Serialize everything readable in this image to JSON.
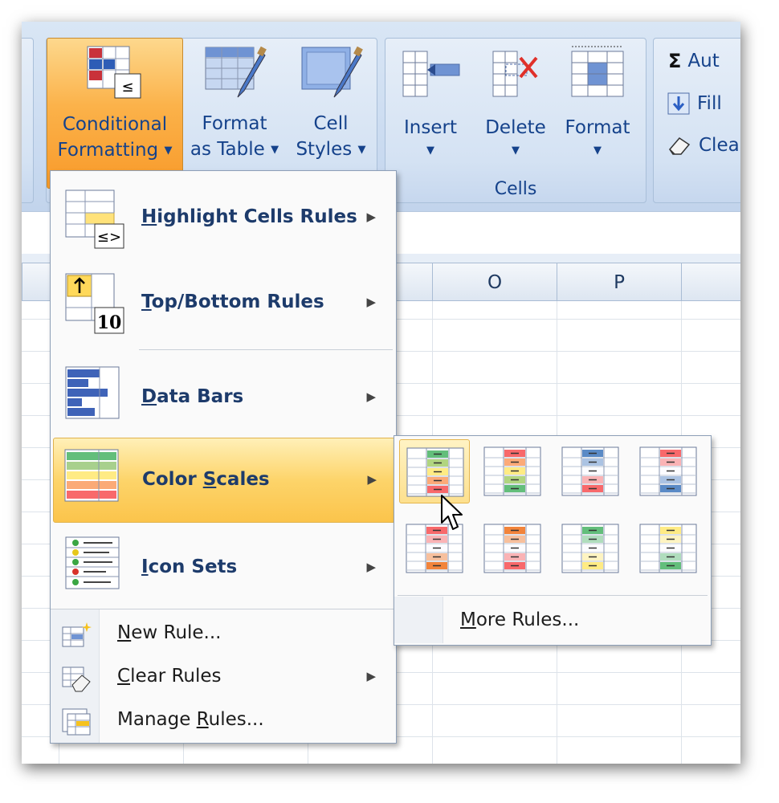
{
  "ribbon": {
    "styles_group": {
      "conditional_formatting": {
        "line1": "Conditional",
        "line2": "Formatting"
      },
      "format_as_table": {
        "line1": "Format",
        "line2": "as Table"
      },
      "cell_styles": {
        "line1": "Cell",
        "line2": "Styles"
      }
    },
    "cells_group": {
      "caption": "Cells",
      "insert": "Insert",
      "delete": "Delete",
      "format": "Format"
    },
    "editing_group": {
      "autosum": "Aut",
      "fill": "Fill",
      "clear": "Clea"
    }
  },
  "grid": {
    "columns": [
      "O",
      "P"
    ]
  },
  "menu": {
    "items": [
      {
        "label": "Highlight Cells Rules",
        "accel": "H",
        "rest": "ighlight Cells Rules"
      },
      {
        "label": "Top/Bottom Rules",
        "accel": "T",
        "rest": "op/Bottom Rules"
      },
      {
        "label": "Data Bars",
        "accel": "D",
        "rest": "ata Bars"
      },
      {
        "label": "Color Scales",
        "pre": "Color ",
        "accel": "S",
        "rest": "cales"
      },
      {
        "label": "Icon Sets",
        "accel": "I",
        "rest": "con Sets"
      }
    ],
    "small_items": [
      {
        "label": "New Rule...",
        "accel": "N",
        "rest": "ew Rule..."
      },
      {
        "label": "Clear Rules",
        "accel": "C",
        "rest": "lear Rules"
      },
      {
        "label": "Manage Rules...",
        "pre": "Manage ",
        "accel": "R",
        "rest": "ules..."
      }
    ]
  },
  "submenu": {
    "more_rules": {
      "accel": "M",
      "rest": "ore Rules..."
    },
    "scales": [
      [
        "#63be7b",
        "#ffeb84",
        "#f8696b"
      ],
      [
        "#f8696b",
        "#ffeb84",
        "#63be7b"
      ],
      [
        "#5a8ac6",
        "#fcfcff",
        "#f8696b"
      ],
      [
        "#f8696b",
        "#fcfcff",
        "#5a8ac6"
      ],
      [
        "#f8696b",
        "#fcfcff",
        "#f2843b"
      ],
      [
        "#f2843b",
        "#fcfcff",
        "#f8696b"
      ],
      [
        "#63be7b",
        "#fcfcff",
        "#ffeb84"
      ],
      [
        "#ffeb84",
        "#fcfcff",
        "#63be7b"
      ]
    ]
  }
}
